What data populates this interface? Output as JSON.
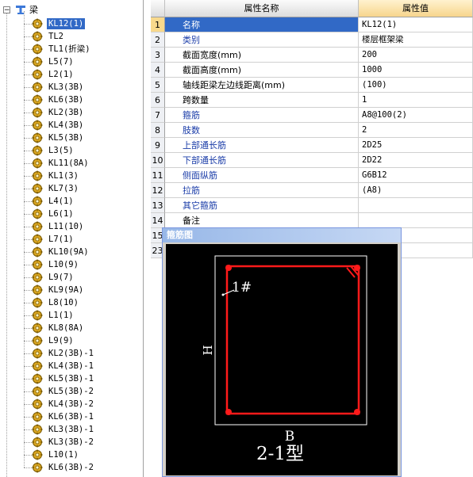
{
  "tree": {
    "root_label": "梁",
    "items": [
      {
        "label": "KL12(1)",
        "selected": true
      },
      {
        "label": "TL2"
      },
      {
        "label": "TL1(折梁)"
      },
      {
        "label": "L5(7)"
      },
      {
        "label": "L2(1)"
      },
      {
        "label": "KL3(3B)"
      },
      {
        "label": "KL6(3B)"
      },
      {
        "label": "KL2(3B)"
      },
      {
        "label": "KL4(3B)"
      },
      {
        "label": "KL5(3B)"
      },
      {
        "label": "L3(5)"
      },
      {
        "label": "KL11(8A)"
      },
      {
        "label": "KL1(3)"
      },
      {
        "label": "KL7(3)"
      },
      {
        "label": "L4(1)"
      },
      {
        "label": "L6(1)"
      },
      {
        "label": "L11(10)"
      },
      {
        "label": "L7(1)"
      },
      {
        "label": "KL10(9A)"
      },
      {
        "label": "L10(9)"
      },
      {
        "label": "L9(7)"
      },
      {
        "label": "KL9(9A)"
      },
      {
        "label": "L8(10)"
      },
      {
        "label": "L1(1)"
      },
      {
        "label": "KL8(8A)"
      },
      {
        "label": "L9(9)"
      },
      {
        "label": "KL2(3B)-1"
      },
      {
        "label": "KL4(3B)-1"
      },
      {
        "label": "KL5(3B)-1"
      },
      {
        "label": "KL5(3B)-2"
      },
      {
        "label": "KL4(3B)-2"
      },
      {
        "label": "KL6(3B)-1"
      },
      {
        "label": "KL3(3B)-1"
      },
      {
        "label": "KL3(3B)-2"
      },
      {
        "label": "L10(1)"
      },
      {
        "label": "KL6(3B)-2"
      }
    ]
  },
  "grid": {
    "header_name": "属性名称",
    "header_value": "属性值",
    "rows": [
      {
        "num": "1",
        "name": "名称",
        "value": "KL12(1)",
        "blue": false,
        "selected": true
      },
      {
        "num": "2",
        "name": "类别",
        "value": "楼层框架梁",
        "blue": true
      },
      {
        "num": "3",
        "name": "截面宽度(mm)",
        "value": "200",
        "blue": false
      },
      {
        "num": "4",
        "name": "截面高度(mm)",
        "value": "1000",
        "blue": false
      },
      {
        "num": "5",
        "name": "轴线距梁左边线距离(mm)",
        "value": "(100)",
        "blue": false
      },
      {
        "num": "6",
        "name": "跨数量",
        "value": "1",
        "blue": false
      },
      {
        "num": "7",
        "name": "箍筋",
        "value": "A8@100(2)",
        "blue": true
      },
      {
        "num": "8",
        "name": "肢数",
        "value": "2",
        "blue": true
      },
      {
        "num": "9",
        "name": "上部通长筋",
        "value": "2D25",
        "blue": true
      },
      {
        "num": "10",
        "name": "下部通长筋",
        "value": "2D22",
        "blue": true
      },
      {
        "num": "11",
        "name": "侧面纵筋",
        "value": "G6B12",
        "blue": true
      },
      {
        "num": "12",
        "name": "拉筋",
        "value": "(A8)",
        "blue": true
      },
      {
        "num": "13",
        "name": "其它箍筋",
        "value": "",
        "blue": true
      },
      {
        "num": "14",
        "name": "备注",
        "value": "",
        "blue": false
      },
      {
        "num": "15",
        "name": "",
        "value": "",
        "blue": false
      },
      {
        "num": "23",
        "name": "",
        "value": "",
        "blue": false
      }
    ]
  },
  "dialog": {
    "title": "箍筋图",
    "label_1": "1#",
    "label_h": "H",
    "label_b": "B",
    "label_type": "2-1型"
  },
  "colors": {
    "selection": "#3169c6",
    "stirrup": "#ff1a1a",
    "dialog_bg": "#000000"
  }
}
